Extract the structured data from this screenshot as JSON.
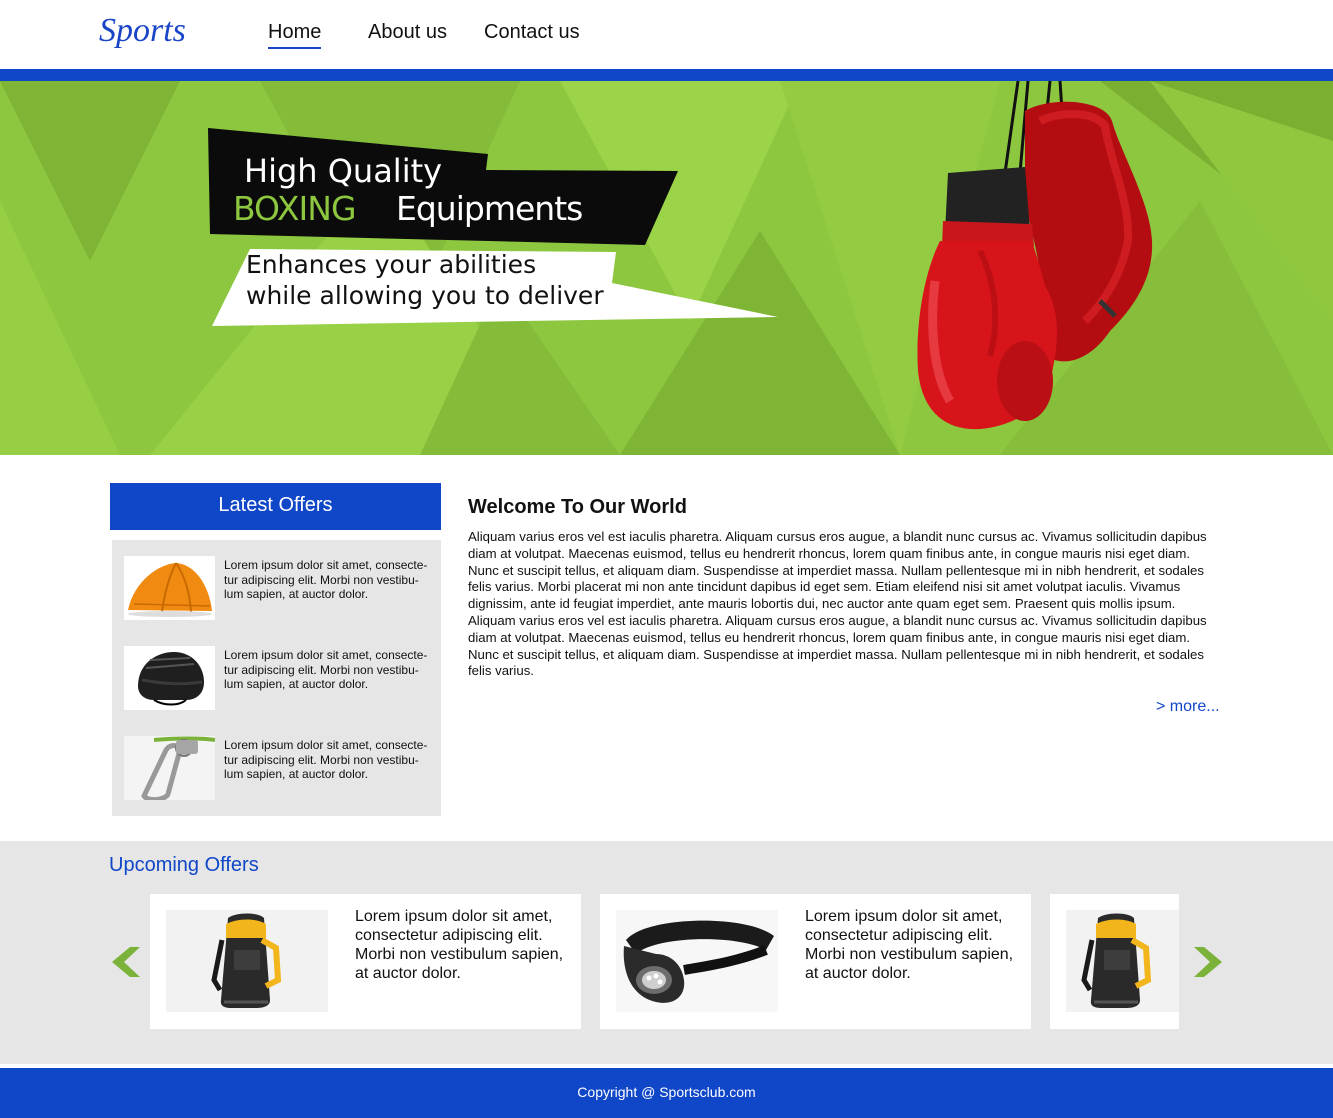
{
  "header": {
    "logo": "Sports",
    "nav": [
      {
        "label": "Home",
        "active": true
      },
      {
        "label": "About us"
      },
      {
        "label": "Contact us"
      }
    ]
  },
  "hero": {
    "line1": "High Quality",
    "line2_accent": "BOXING",
    "line2_rest": "Equipments",
    "tagline_1": "Enhances your abilities",
    "tagline_2": "while allowing you to deliver",
    "image": "boxing-gloves-image"
  },
  "latest_offers": {
    "title": "Latest Offers",
    "items": [
      {
        "image": "tent-image",
        "text": "Lorem ipsum dolor sit amet, consecte-tur adipiscing elit. Morbi non vestibu-lum sapien, at auctor dolor."
      },
      {
        "image": "helmet-image",
        "text": "Lorem ipsum dolor sit amet, consecte-tur adipiscing elit. Morbi non vestibu-lum sapien, at auctor dolor."
      },
      {
        "image": "carabiner-image",
        "text": "Lorem ipsum dolor sit amet, consecte-tur adipiscing elit. Morbi non vestibu-lum sapien, at auctor dolor."
      }
    ]
  },
  "welcome": {
    "title": "Welcome To Our World",
    "body": "Aliquam varius eros vel est iaculis pharetra. Aliquam cursus eros augue, a blandit nunc cursus ac. Vivamus sollicitudin dapibus diam at volutpat. Maecenas euismod, tellus eu hendrerit rhoncus, lorem quam finibus ante, in congue mauris nisi eget diam. Nunc et suscipit tellus, et aliquam diam. Suspendisse at imperdiet massa. Nullam pellentesque mi in nibh hendrerit, et sodales felis varius. Morbi placerat mi non ante tincidunt dapibus id eget sem. Etiam eleifend nisi sit amet volutpat iaculis. Vivamus dignissim, ante id feugiat imperdiet, ante mauris lobortis dui, nec auctor ante quam eget sem. Praesent quis mollis ipsum. Aliquam varius eros vel est iaculis pharetra. Aliquam cursus eros augue, a blandit nunc cursus ac. Vivamus sollicitudin dapibus diam at volutpat. Maecenas euismod, tellus eu hendrerit rhoncus, lorem quam finibus ante, in congue mauris nisi eget diam. Nunc et suscipit tellus, et aliquam diam. Suspendisse at imperdiet massa. Nullam pellentesque mi in nibh hendrerit, et sodales felis varius.",
    "more_label": "> more..."
  },
  "upcoming_offers": {
    "title": "Upcoming Offers",
    "prev_icon": "chevron-left-icon",
    "next_icon": "chevron-right-icon",
    "items": [
      {
        "image": "backpack-image",
        "text": "Lorem ipsum dolor sit amet, consectetur adipiscing elit. Morbi non vestibulum sapien, at auctor dolor."
      },
      {
        "image": "headlamp-image",
        "text": "Lorem ipsum dolor sit amet, consectetur adipiscing elit. Morbi non vestibulum sapien, at auctor dolor."
      },
      {
        "image": "backpack-image",
        "text": ""
      }
    ]
  },
  "footer": {
    "copyright": "Copyright @ Sportsclub.com"
  },
  "colors": {
    "brand_blue": "#1046c8",
    "hero_green": "#8dc63f",
    "panel_gray": "#e6e6e6",
    "glove_red": "#d8141b"
  }
}
